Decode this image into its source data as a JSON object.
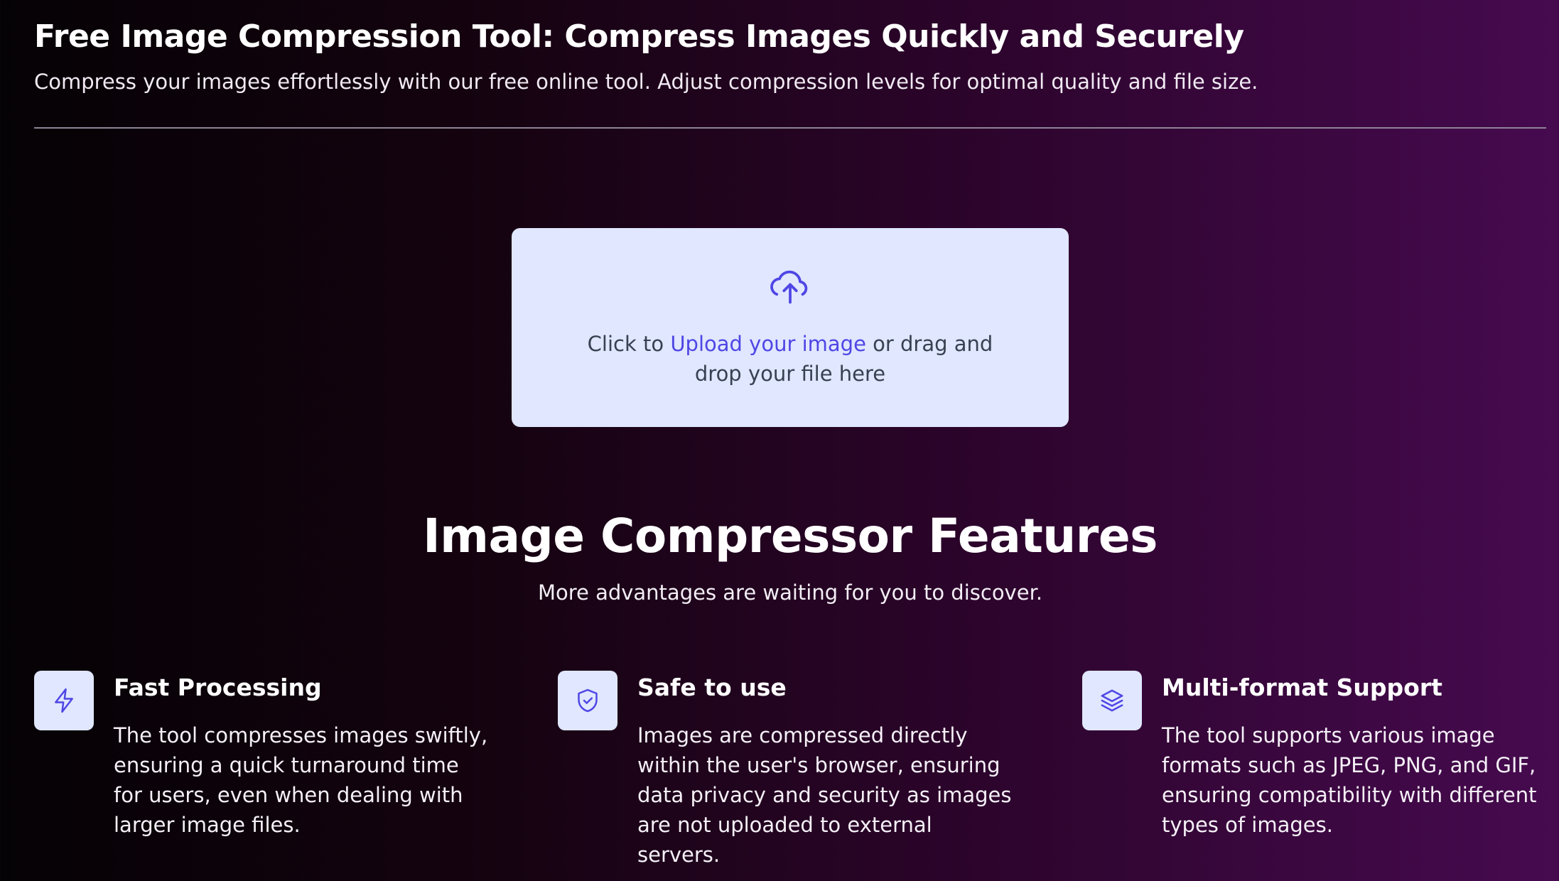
{
  "header": {
    "title": "Free Image Compression Tool: Compress Images Quickly and Securely",
    "subtitle": "Compress your images effortlessly with our free online tool. Adjust compression levels for optimal quality and file size."
  },
  "upload": {
    "icon": "cloud-upload-icon",
    "prefix": "Click to ",
    "link_label": "Upload your image",
    "suffix": " or drag and drop your file here",
    "accent_color": "#4f46e5",
    "box_color": "#e0e7ff"
  },
  "features": {
    "title": "Image Compressor Features",
    "subtitle": "More advantages are waiting for you to discover.",
    "items": [
      {
        "icon": "lightning-bolt-icon",
        "title": "Fast Processing",
        "description": "The tool compresses images swiftly, ensuring a quick turnaround time for users, even when dealing with larger image files."
      },
      {
        "icon": "shield-check-icon",
        "title": "Safe to use",
        "description": "Images are compressed directly within the user's browser, ensuring data privacy and security as images are not uploaded to external servers."
      },
      {
        "icon": "layers-icon",
        "title": "Multi-format Support",
        "description": "The tool supports various image formats such as JPEG, PNG, and GIF, ensuring compatibility with different types of images."
      }
    ]
  }
}
